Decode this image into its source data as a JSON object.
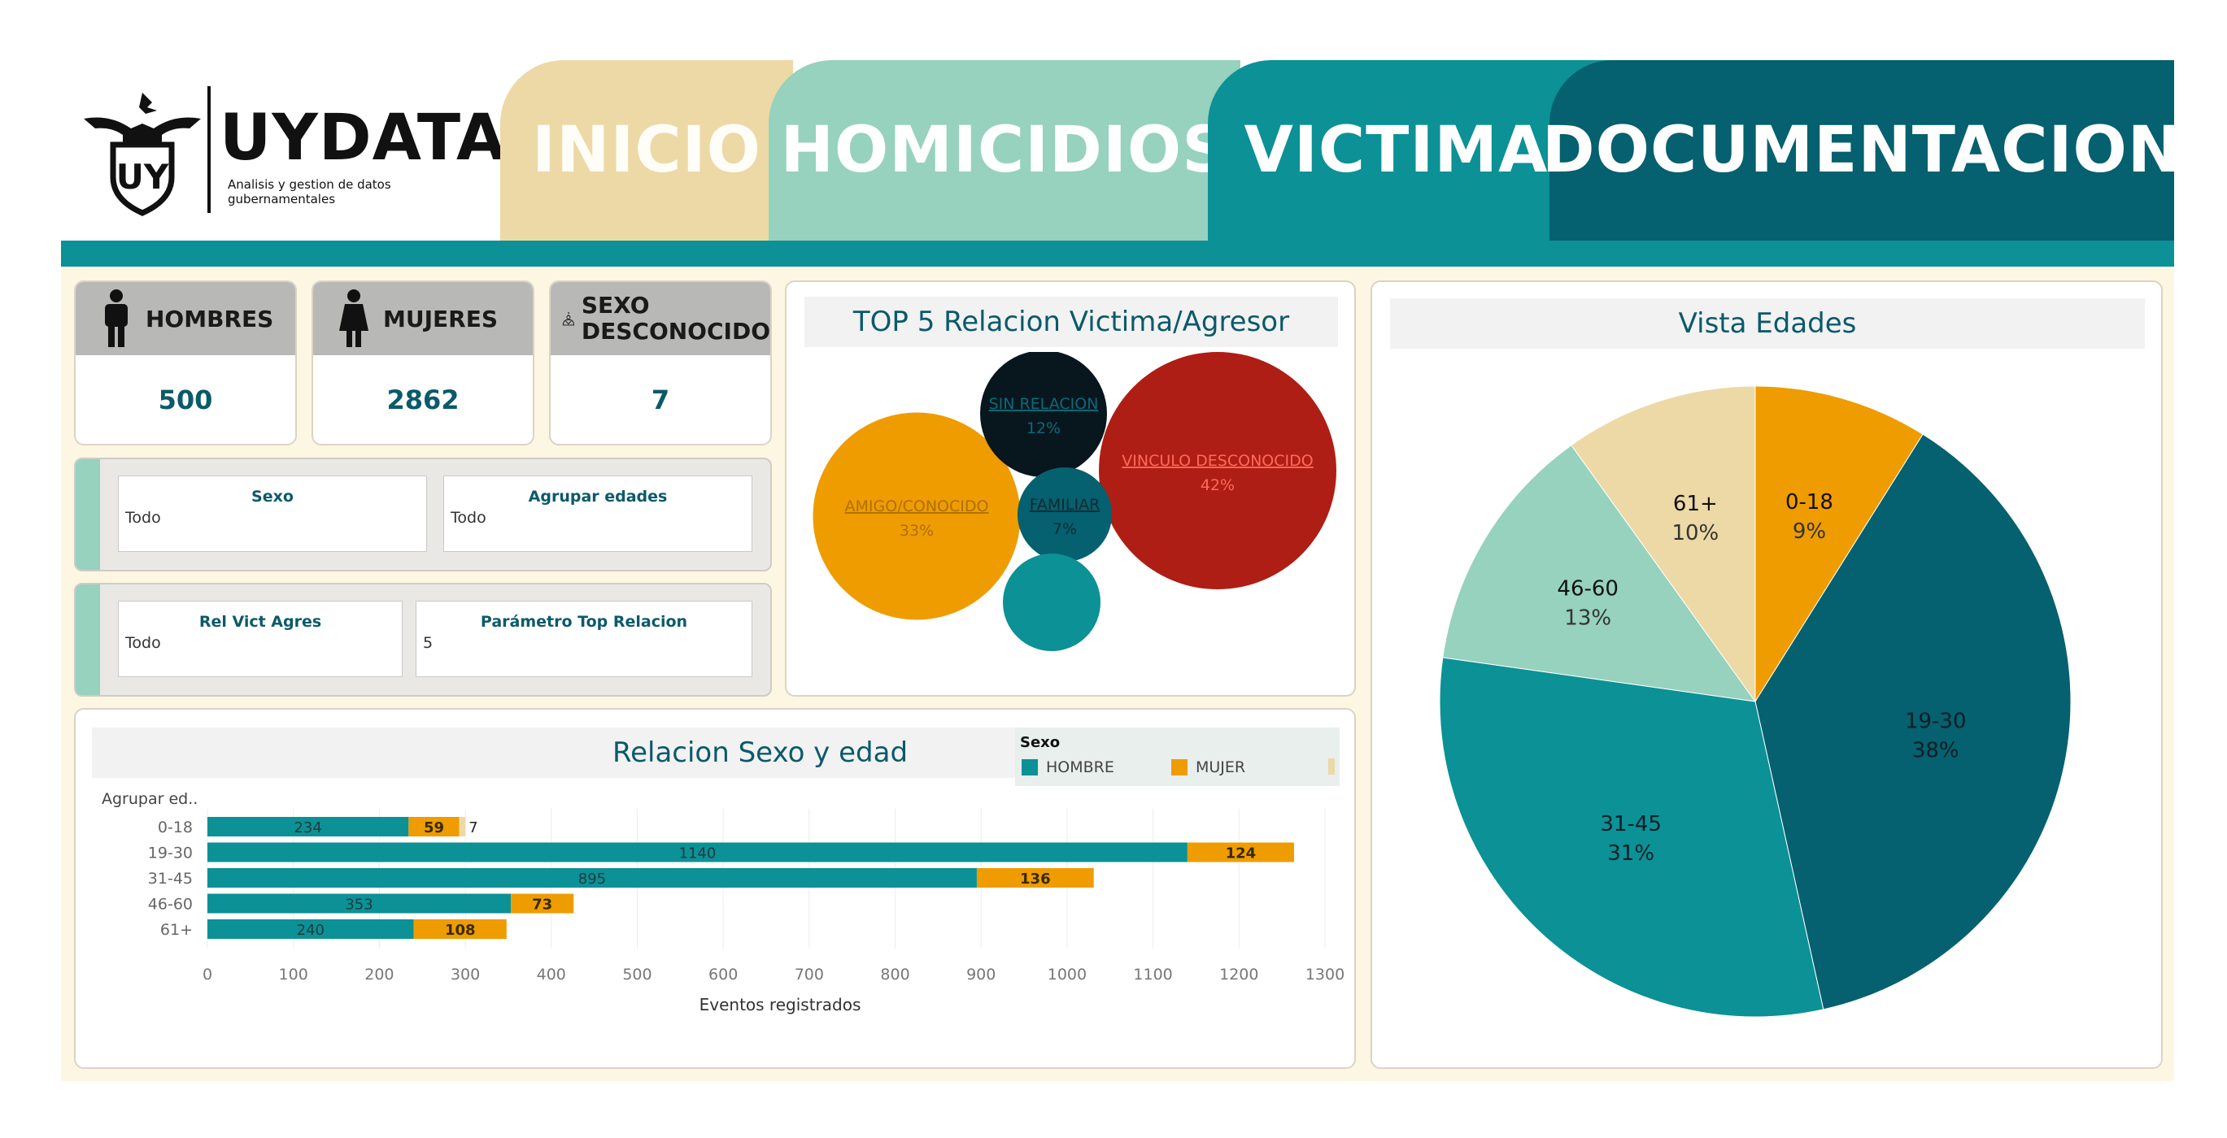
{
  "logo": {
    "title": "UYDATA",
    "subtitle": "Analisis y gestion de datos gubernamentales",
    "badge": "UY"
  },
  "nav": {
    "inicio": "INICIO",
    "homicidios": "HOMICIDIOS",
    "victimas": "VICTIMAS",
    "documentacion": "DOCUMENTACION"
  },
  "kpis": {
    "hombres": {
      "label": "HOMBRES",
      "value": "500"
    },
    "mujeres": {
      "label": "MUJERES",
      "value": "2862"
    },
    "desconocido": {
      "label_1": "SEXO",
      "label_2": "DESCONOCIDO",
      "value": "7"
    }
  },
  "filters": {
    "sexo": {
      "title": "Sexo",
      "value": "Todo"
    },
    "agrupar": {
      "title": "Agrupar edades",
      "value": "Todo"
    },
    "relvict": {
      "title": "Rel Vict Agres",
      "value": "Todo"
    },
    "param": {
      "title": "Parámetro Top Relacion",
      "value": "5"
    }
  },
  "colors": {
    "hombre": "#0b9196",
    "mujer": "#ee9c00",
    "dark_teal": "#05606f",
    "light_teal": "#96d2bd",
    "beige": "#ecd9a6",
    "navy": "#08161d",
    "red": "#ae1e14"
  },
  "chart_data": [
    {
      "type": "bubble",
      "title": "TOP 5 Relacion Victima/Agresor",
      "bubbles": [
        {
          "label": "VINCULO DESCONOCIDO",
          "pct": "42%",
          "value": 42,
          "color": "#ae1e14",
          "text_color": "#ff6a5a"
        },
        {
          "label": "AMIGO/CONOCIDO",
          "pct": "33%",
          "value": 33,
          "color": "#ee9c00",
          "text_color": "#b06f00"
        },
        {
          "label": "SIN RELACION",
          "pct": "12%",
          "value": 12,
          "color": "#08161d",
          "text_color": "#0b6a7a"
        },
        {
          "label": "FAMILIAR",
          "pct": "7%",
          "value": 7,
          "color": "#05606f",
          "text_color": "#0d2a30"
        },
        {
          "label": "",
          "pct": "",
          "value": 6,
          "color": "#0b9196",
          "text_color": "#ffffff"
        }
      ]
    },
    {
      "type": "bar",
      "title": "Relacion Sexo y edad",
      "categories_label": "Agrupar ed..",
      "categories": [
        "0-18",
        "19-30",
        "31-45",
        "46-60",
        "61+"
      ],
      "series": [
        {
          "name": "HOMBRE",
          "values": [
            234,
            1140,
            895,
            353,
            240
          ],
          "labels": [
            "234",
            "1140",
            "895",
            "353",
            "240"
          ]
        },
        {
          "name": "MUJER",
          "values": [
            59,
            124,
            136,
            73,
            108
          ],
          "labels": [
            "59",
            "124",
            "136",
            "73",
            "108"
          ]
        },
        {
          "name": "",
          "values": [
            7,
            0,
            0,
            0,
            0
          ],
          "labels": [
            "7",
            "",
            "",
            "",
            ""
          ]
        }
      ],
      "legend_title": "Sexo",
      "xlabel": "Eventos registrados",
      "xticks": [
        "0",
        "100",
        "200",
        "300",
        "400",
        "500",
        "600",
        "700",
        "800",
        "900",
        "1000",
        "1100",
        "1200",
        "1300"
      ],
      "xlim": [
        0,
        1300
      ],
      "grid": true,
      "legend_position": "top-right"
    },
    {
      "type": "pie",
      "title": "Vista Edades",
      "slices": [
        {
          "label": "0-18",
          "pct": "9%",
          "value": 9,
          "color": "#ee9c00"
        },
        {
          "label": "19-30",
          "pct": "38%",
          "value": 38,
          "color": "#05606f"
        },
        {
          "label": "31-45",
          "pct": "31%",
          "value": 31,
          "color": "#0b9196"
        },
        {
          "label": "46-60",
          "pct": "13%",
          "value": 13,
          "color": "#96d2bd"
        },
        {
          "label": "61+",
          "pct": "10%",
          "value": 10,
          "color": "#ecd9a6"
        }
      ]
    }
  ]
}
